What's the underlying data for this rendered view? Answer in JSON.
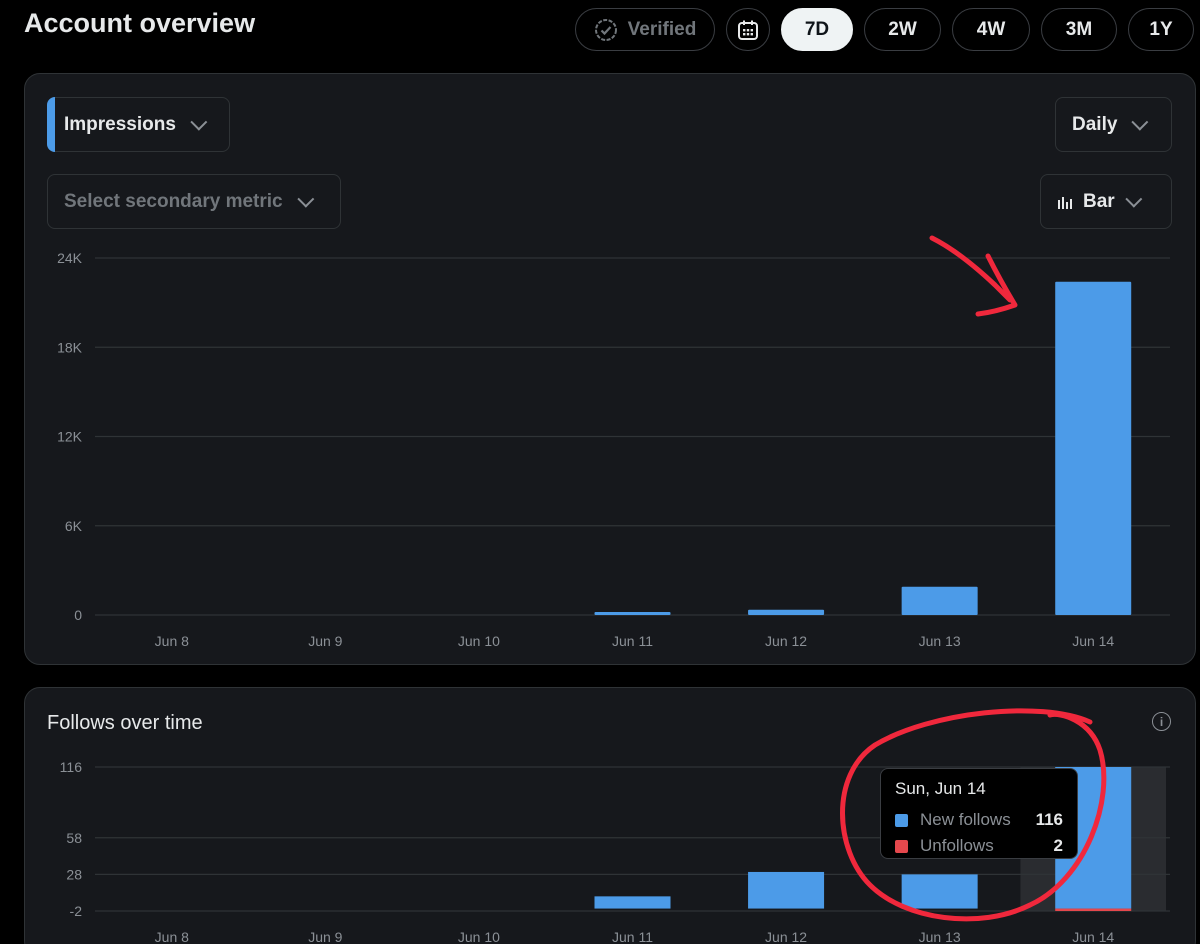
{
  "header": {
    "title": "Account overview",
    "verified_label": "Verified",
    "calendar_icon": "calendar-icon",
    "ranges": [
      "7D",
      "2W",
      "4W",
      "3M",
      "1Y"
    ],
    "active_range": "7D"
  },
  "impressions_card": {
    "primary_metric": "Impressions",
    "secondary_metric_placeholder": "Select secondary metric",
    "granularity": "Daily",
    "chart_type_label": "Bar",
    "accent_color": "#4c9be8"
  },
  "follows_card": {
    "title": "Follows over time",
    "tooltip": {
      "date": "Sun, Jun 14",
      "rows": [
        {
          "label": "New follows",
          "value": "116",
          "color": "#4c9be8"
        },
        {
          "label": "Unfollows",
          "value": "2",
          "color": "#e5484d"
        }
      ]
    }
  },
  "chart_data": [
    {
      "type": "bar",
      "categories": [
        "Jun 8",
        "Jun 9",
        "Jun 10",
        "Jun 11",
        "Jun 12",
        "Jun 13",
        "Jun 14"
      ],
      "values": [
        0,
        0,
        0,
        200,
        350,
        1900,
        22400
      ],
      "ylim": [
        0,
        24000
      ],
      "yticks": [
        "0",
        "6K",
        "12K",
        "18K",
        "24K"
      ],
      "ytick_values": [
        0,
        6000,
        12000,
        18000,
        24000
      ],
      "grid": true,
      "color": "#4c9be8"
    },
    {
      "type": "bar",
      "categories": [
        "Jun 8",
        "Jun 9",
        "Jun 10",
        "Jun 11",
        "Jun 12",
        "Jun 13",
        "Jun 14"
      ],
      "series": [
        {
          "name": "New follows",
          "values": [
            0,
            0,
            0,
            10,
            30,
            28,
            116
          ],
          "color": "#4c9be8"
        },
        {
          "name": "Unfollows",
          "values": [
            0,
            0,
            0,
            0,
            0,
            0,
            2
          ],
          "color": "#e5484d"
        }
      ],
      "ylim": [
        -2,
        116
      ],
      "yticks": [
        "-2",
        "28",
        "58",
        "116"
      ],
      "ytick_values": [
        -2,
        28,
        58,
        116
      ],
      "grid": true,
      "highlighted_category": "Jun 14"
    }
  ]
}
